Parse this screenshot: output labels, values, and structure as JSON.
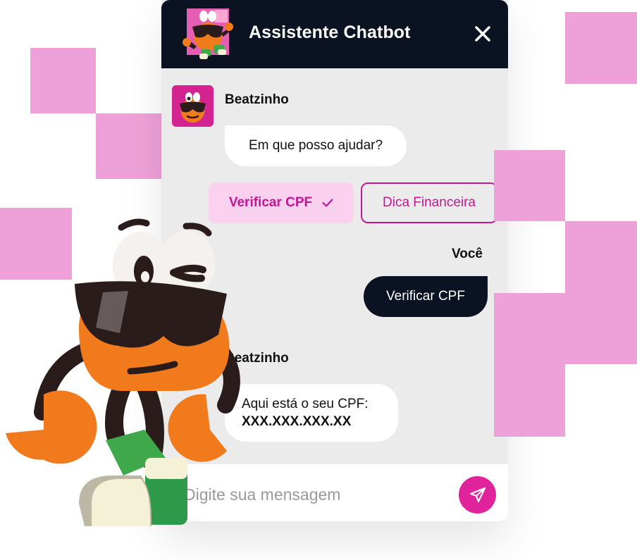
{
  "header": {
    "title": "Assistente Chatbot",
    "close_icon": "close-icon"
  },
  "messages": [
    {
      "sender": "Beatzinho",
      "text": "Em que posso ajudar?"
    },
    {
      "sender": "Você",
      "text": "Verificar CPF"
    },
    {
      "sender": "Beatzinho",
      "line1": "Aqui está o seu CPF:",
      "line2": "XXX.XXX.XXX.XX"
    }
  ],
  "quick_replies": [
    {
      "label": "Verificar CPF",
      "selected": true,
      "icon": "check-icon"
    },
    {
      "label": "Dica Financeira",
      "selected": false
    }
  ],
  "input": {
    "placeholder": "Digite sua mensagem",
    "send_icon": "send-icon"
  },
  "colors": {
    "header_bg": "#0b1322",
    "accent": "#e0239b",
    "accent_text": "#c21793",
    "selected_bg": "#fad1ee",
    "decor_pink": "#eea1d8",
    "chat_bg": "#ebebeb"
  }
}
